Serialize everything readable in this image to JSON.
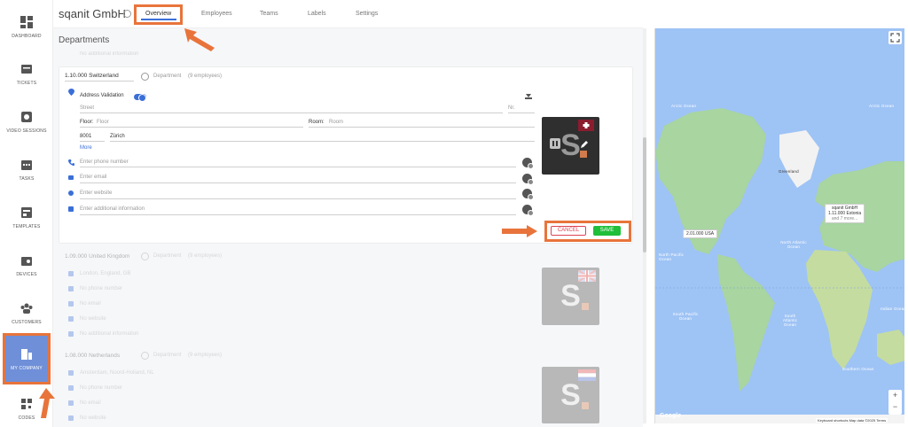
{
  "sidebar": {
    "items": [
      {
        "label": "DASHBOARD",
        "icon": "dashboard-icon"
      },
      {
        "label": "TICKETS",
        "icon": "ticket-icon"
      },
      {
        "label": "VIDEO SESSIONS",
        "icon": "video-icon"
      },
      {
        "label": "TASKS",
        "icon": "calendar-icon"
      },
      {
        "label": "TEMPLATES",
        "icon": "template-icon"
      },
      {
        "label": "DEVICES",
        "icon": "device-icon"
      },
      {
        "label": "CUSTOMERS",
        "icon": "customers-icon"
      },
      {
        "label": "MY COMPANY",
        "icon": "building-icon"
      },
      {
        "label": "CODES",
        "icon": "codes-icon"
      }
    ]
  },
  "header": {
    "company": "sqanit GmbH",
    "tabs": [
      "Overview",
      "Employees",
      "Teams",
      "Labels",
      "Settings"
    ]
  },
  "departments_title": "Departments",
  "top_placeholder": "No additional information",
  "dept1": {
    "name": "1.10.000 Switzerland",
    "type_label": "Department",
    "employees": "(9 employees)",
    "address_validation": "Address Validation",
    "street": "Street",
    "nr": "Nr.",
    "floor_label": "Floor:",
    "floor_placeholder": "Floor",
    "room_label": "Room:",
    "room_placeholder": "Room",
    "zip": "8001",
    "city": "Zürich",
    "more": "More",
    "phone": "Enter phone number",
    "email": "Enter email",
    "website": "Enter website",
    "additional": "Enter additional information",
    "cancel": "CANCEL",
    "save": "SAVE"
  },
  "dept2": {
    "name": "1.09.000 United Kingdom",
    "type_label": "Department",
    "employees": "(9 employees)",
    "address": "London, England, GB",
    "phone": "No phone number",
    "email": "No email",
    "website": "No website",
    "additional": "No additional information"
  },
  "dept3": {
    "name": "1.08.000 Netherlands",
    "type_label": "Department",
    "employees": "(9 employees)",
    "address": "Amsterdam, Noord-Holland, NL",
    "phone": "No phone number",
    "email": "No email",
    "website": "No website"
  },
  "map": {
    "labels": [
      "Arctic Ocean",
      "Arctic Ocean",
      "Greenland",
      "North Atlantic Ocean",
      "North Pacific Ocean",
      "South Pacific Ocean",
      "South Atlantic Ocean",
      "Indian Ocean",
      "Southern Ocean"
    ],
    "tip1_line1": "sqanit GmbH",
    "tip1_line2": "1.11.000 Estonia",
    "tip1_line3": "and 7 more...",
    "tip2": "2.01.000 USA",
    "google": "Google",
    "footer": "Keyboard shortcuts   Map data ©2025   Terms",
    "zoom_in": "+",
    "zoom_out": "−"
  },
  "colors": {
    "accent": "#3b6fd8",
    "highlight": "#e8743b",
    "save": "#1fbf3a",
    "cancel": "#dd4455",
    "ocean": "#9ec3f5",
    "land": "#a8d5a0"
  }
}
